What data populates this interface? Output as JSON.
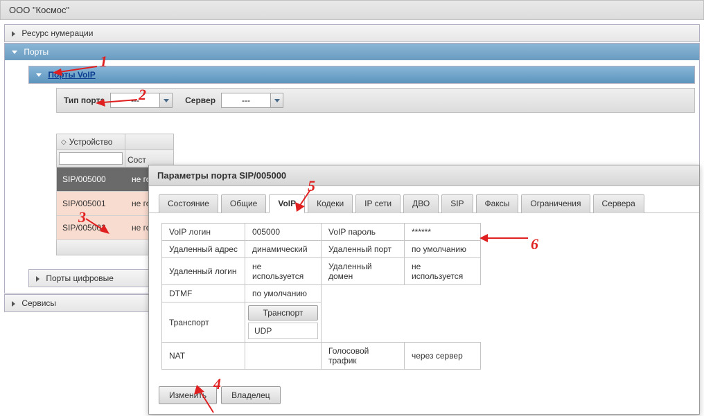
{
  "header": {
    "title": "ООО \"Космос\""
  },
  "accordion": {
    "numbering": "Ресурс нумерации",
    "ports": "Порты",
    "ports_voip": "Порты VoIP",
    "ports_digital": "Порты цифровые",
    "services": "Сервисы"
  },
  "toolbar": {
    "port_type_label": "Тип порта",
    "port_type_value": "---",
    "server_label": "Сервер",
    "server_value": "---"
  },
  "grid": {
    "col_device": "Устройство",
    "col_state_trunc": "Сост",
    "rows": [
      {
        "device": "SIP/005000",
        "state_trunc": "не го",
        "selected": true
      },
      {
        "device": "SIP/005001",
        "state_trunc": "не го",
        "selected": false
      },
      {
        "device": "SIP/005002",
        "state_trunc": "не го",
        "selected": false
      }
    ]
  },
  "dialog": {
    "title": "Параметры порта SIP/005000",
    "tabs": [
      "Состояние",
      "Общие",
      "VoIP",
      "Кодеки",
      "IP сети",
      "ДВО",
      "SIP",
      "Факсы",
      "Ограничения",
      "Сервера"
    ],
    "active_tab": 2,
    "voip": {
      "login_label": "VoIP логин",
      "login_value": "005000",
      "password_label": "VoIP пароль",
      "password_value": "******",
      "remote_addr_label": "Удаленный адрес",
      "remote_addr_value": "динамический",
      "remote_port_label": "Удаленный порт",
      "remote_port_value": "по умолчанию",
      "remote_login_label": "Удаленный логин",
      "remote_login_value": "не используется",
      "remote_domain_label": "Удаленный домен",
      "remote_domain_value": "не используется",
      "dtmf_label": "DTMF",
      "dtmf_value": "по умолчанию",
      "transport_label": "Транспорт",
      "transport_button": "Транспорт",
      "transport_value": "UDP",
      "nat_label": "NAT",
      "voice_traffic_label": "Голосовой трафик",
      "voice_traffic_value": "через сервер"
    },
    "buttons": {
      "edit": "Изменить",
      "owner": "Владелец"
    }
  },
  "annotations": {
    "n1": "1",
    "n2": "2",
    "n3": "3",
    "n4": "4",
    "n5": "5",
    "n6": "6"
  }
}
